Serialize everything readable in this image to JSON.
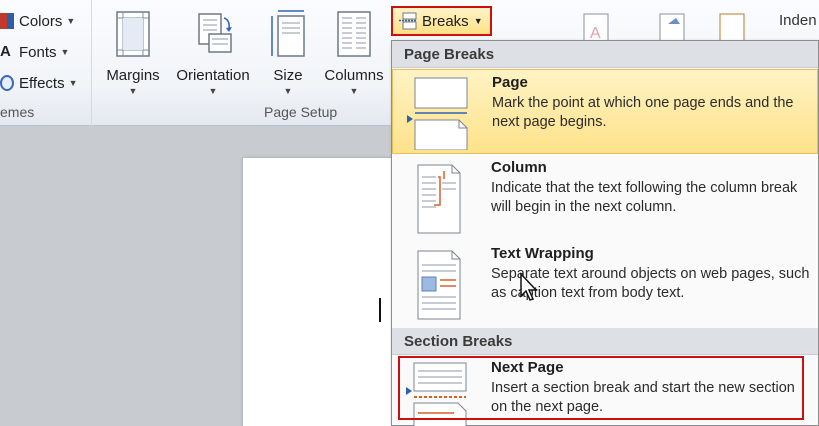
{
  "themes": {
    "items": [
      {
        "label": "Colors",
        "icon": "colors-icon"
      },
      {
        "label": "Fonts",
        "icon": "fonts-icon"
      },
      {
        "label": "Effects",
        "icon": "effects-icon"
      }
    ],
    "group_label": "emes"
  },
  "page_setup": {
    "buttons": [
      {
        "label": "Margins",
        "icon": "margins-icon"
      },
      {
        "label": "Orientation",
        "icon": "orientation-icon"
      },
      {
        "label": "Size",
        "icon": "size-icon"
      },
      {
        "label": "Columns",
        "icon": "columns-icon"
      }
    ],
    "group_label": "Page Setup",
    "breaks_label": "Breaks"
  },
  "indent_label": "Inden",
  "menu": {
    "page_breaks_header": "Page Breaks",
    "section_breaks_header": "Section Breaks",
    "items": [
      {
        "title": "Page",
        "desc": "Mark the point at which one page ends and the next page begins.",
        "icon": "page-break-icon"
      },
      {
        "title": "Column",
        "desc": "Indicate that the text following the column break will begin in the next column.",
        "icon": "column-break-icon"
      },
      {
        "title": "Text Wrapping",
        "desc": "Separate text around objects on web pages, such as caption text from body text.",
        "icon": "text-wrapping-icon"
      },
      {
        "title": "Next Page",
        "desc": "Insert a section break and start the new section on the next page.",
        "icon": "next-page-icon"
      }
    ]
  },
  "colors": {
    "accent_red": "#cc1010",
    "hover_yellow": "#fee28a"
  }
}
